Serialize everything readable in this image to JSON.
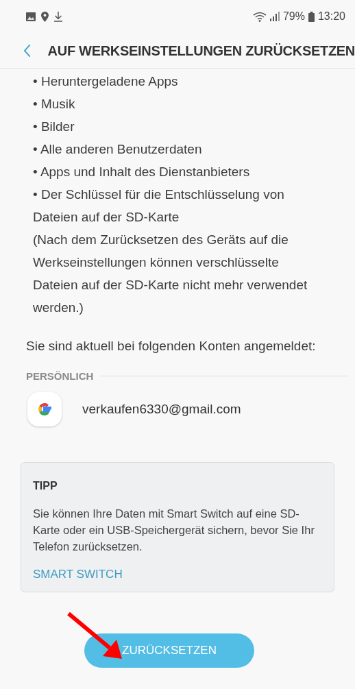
{
  "status_bar": {
    "battery": "79%",
    "time": "13:20"
  },
  "header": {
    "title": "AUF WERKSEINSTELLUNGEN ZURÜCKSETZEN"
  },
  "items": [
    "• Heruntergeladene Apps",
    "• Musik",
    "• Bilder",
    "• Alle anderen Benutzerdaten",
    "• Apps und Inhalt des Dienstanbieters",
    "• Der Schlüssel für die Entschlüsselung von Dateien auf der SD-Karte"
  ],
  "note": "(Nach dem Zurücksetzen des Geräts auf die Werkseinstellungen können verschlüsselte Dateien auf der SD-Karte nicht mehr verwendet werden.)",
  "accounts_intro": "Sie sind aktuell bei folgenden Konten angemeldet:",
  "accounts_section": {
    "heading": "PERSÖNLICH",
    "accounts": [
      {
        "email": "verkaufen6330@gmail.com"
      }
    ]
  },
  "tip": {
    "heading": "TIPP",
    "text": "Sie können Ihre Daten mit Smart Switch auf eine SD-Karte oder ein USB-Speichergerät sichern, bevor Sie Ihr Telefon zurücksetzen.",
    "link": "SMART SWITCH"
  },
  "reset_button": "ZURÜCKSETZEN"
}
